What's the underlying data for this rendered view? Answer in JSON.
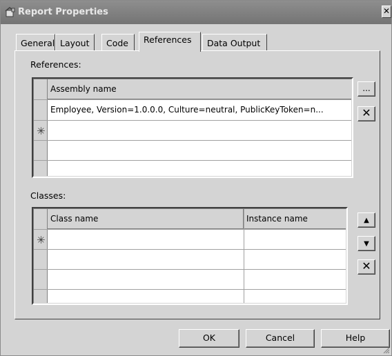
{
  "window": {
    "title": "Report Properties",
    "close_glyph": "✕"
  },
  "tabs": [
    {
      "label": "General"
    },
    {
      "label": "Layout"
    },
    {
      "label": "Code"
    },
    {
      "label": "References"
    },
    {
      "label": "Data Output"
    }
  ],
  "references": {
    "label": "References:",
    "column_header": "Assembly name",
    "rows": [
      "Employee, Version=1.0.0.0, Culture=neutral, PublicKeyToken=n..."
    ],
    "new_row_marker": "✳",
    "browse_button": "...",
    "delete_button": "✕"
  },
  "classes": {
    "label": "Classes:",
    "columns": [
      "Class name",
      "Instance name"
    ],
    "new_row_marker": "✳",
    "move_up_button": "▲",
    "move_down_button": "▼",
    "delete_button": "✕"
  },
  "footer": {
    "ok": "OK",
    "cancel": "Cancel",
    "help": "Help"
  }
}
